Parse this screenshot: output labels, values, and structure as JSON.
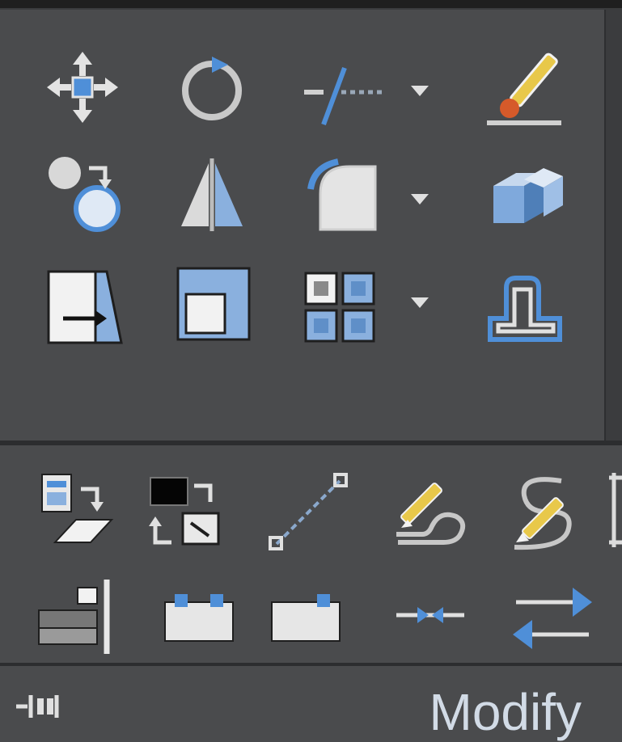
{
  "panel": {
    "title": "Modify"
  },
  "tools_row1": [
    "move-tool",
    "rotate-tool",
    "trim-tool",
    "erase-tool"
  ],
  "tools_row2": [
    "copy-tool",
    "mirror-tool",
    "fillet-tool",
    "solid-editing-tool"
  ],
  "tools_row3": [
    "stretch-tool",
    "scale-tool",
    "array-tool",
    "offset-tool"
  ],
  "expanded_row1": [
    "copy-clip-tool",
    "draworder-tool",
    "break-at-point-tool",
    "edit-polyline-tool",
    "edit-spline-tool"
  ],
  "expanded_row2": [
    "align-tool",
    "break-tool",
    "join-tool",
    "lengthen-tool",
    "reverse-tool"
  ],
  "colors": {
    "panel_bg": "#4a4b4d",
    "accent_blue": "#4f8fd8",
    "icon_light": "#d8d8d8",
    "title_text": "#d2dbe6"
  }
}
